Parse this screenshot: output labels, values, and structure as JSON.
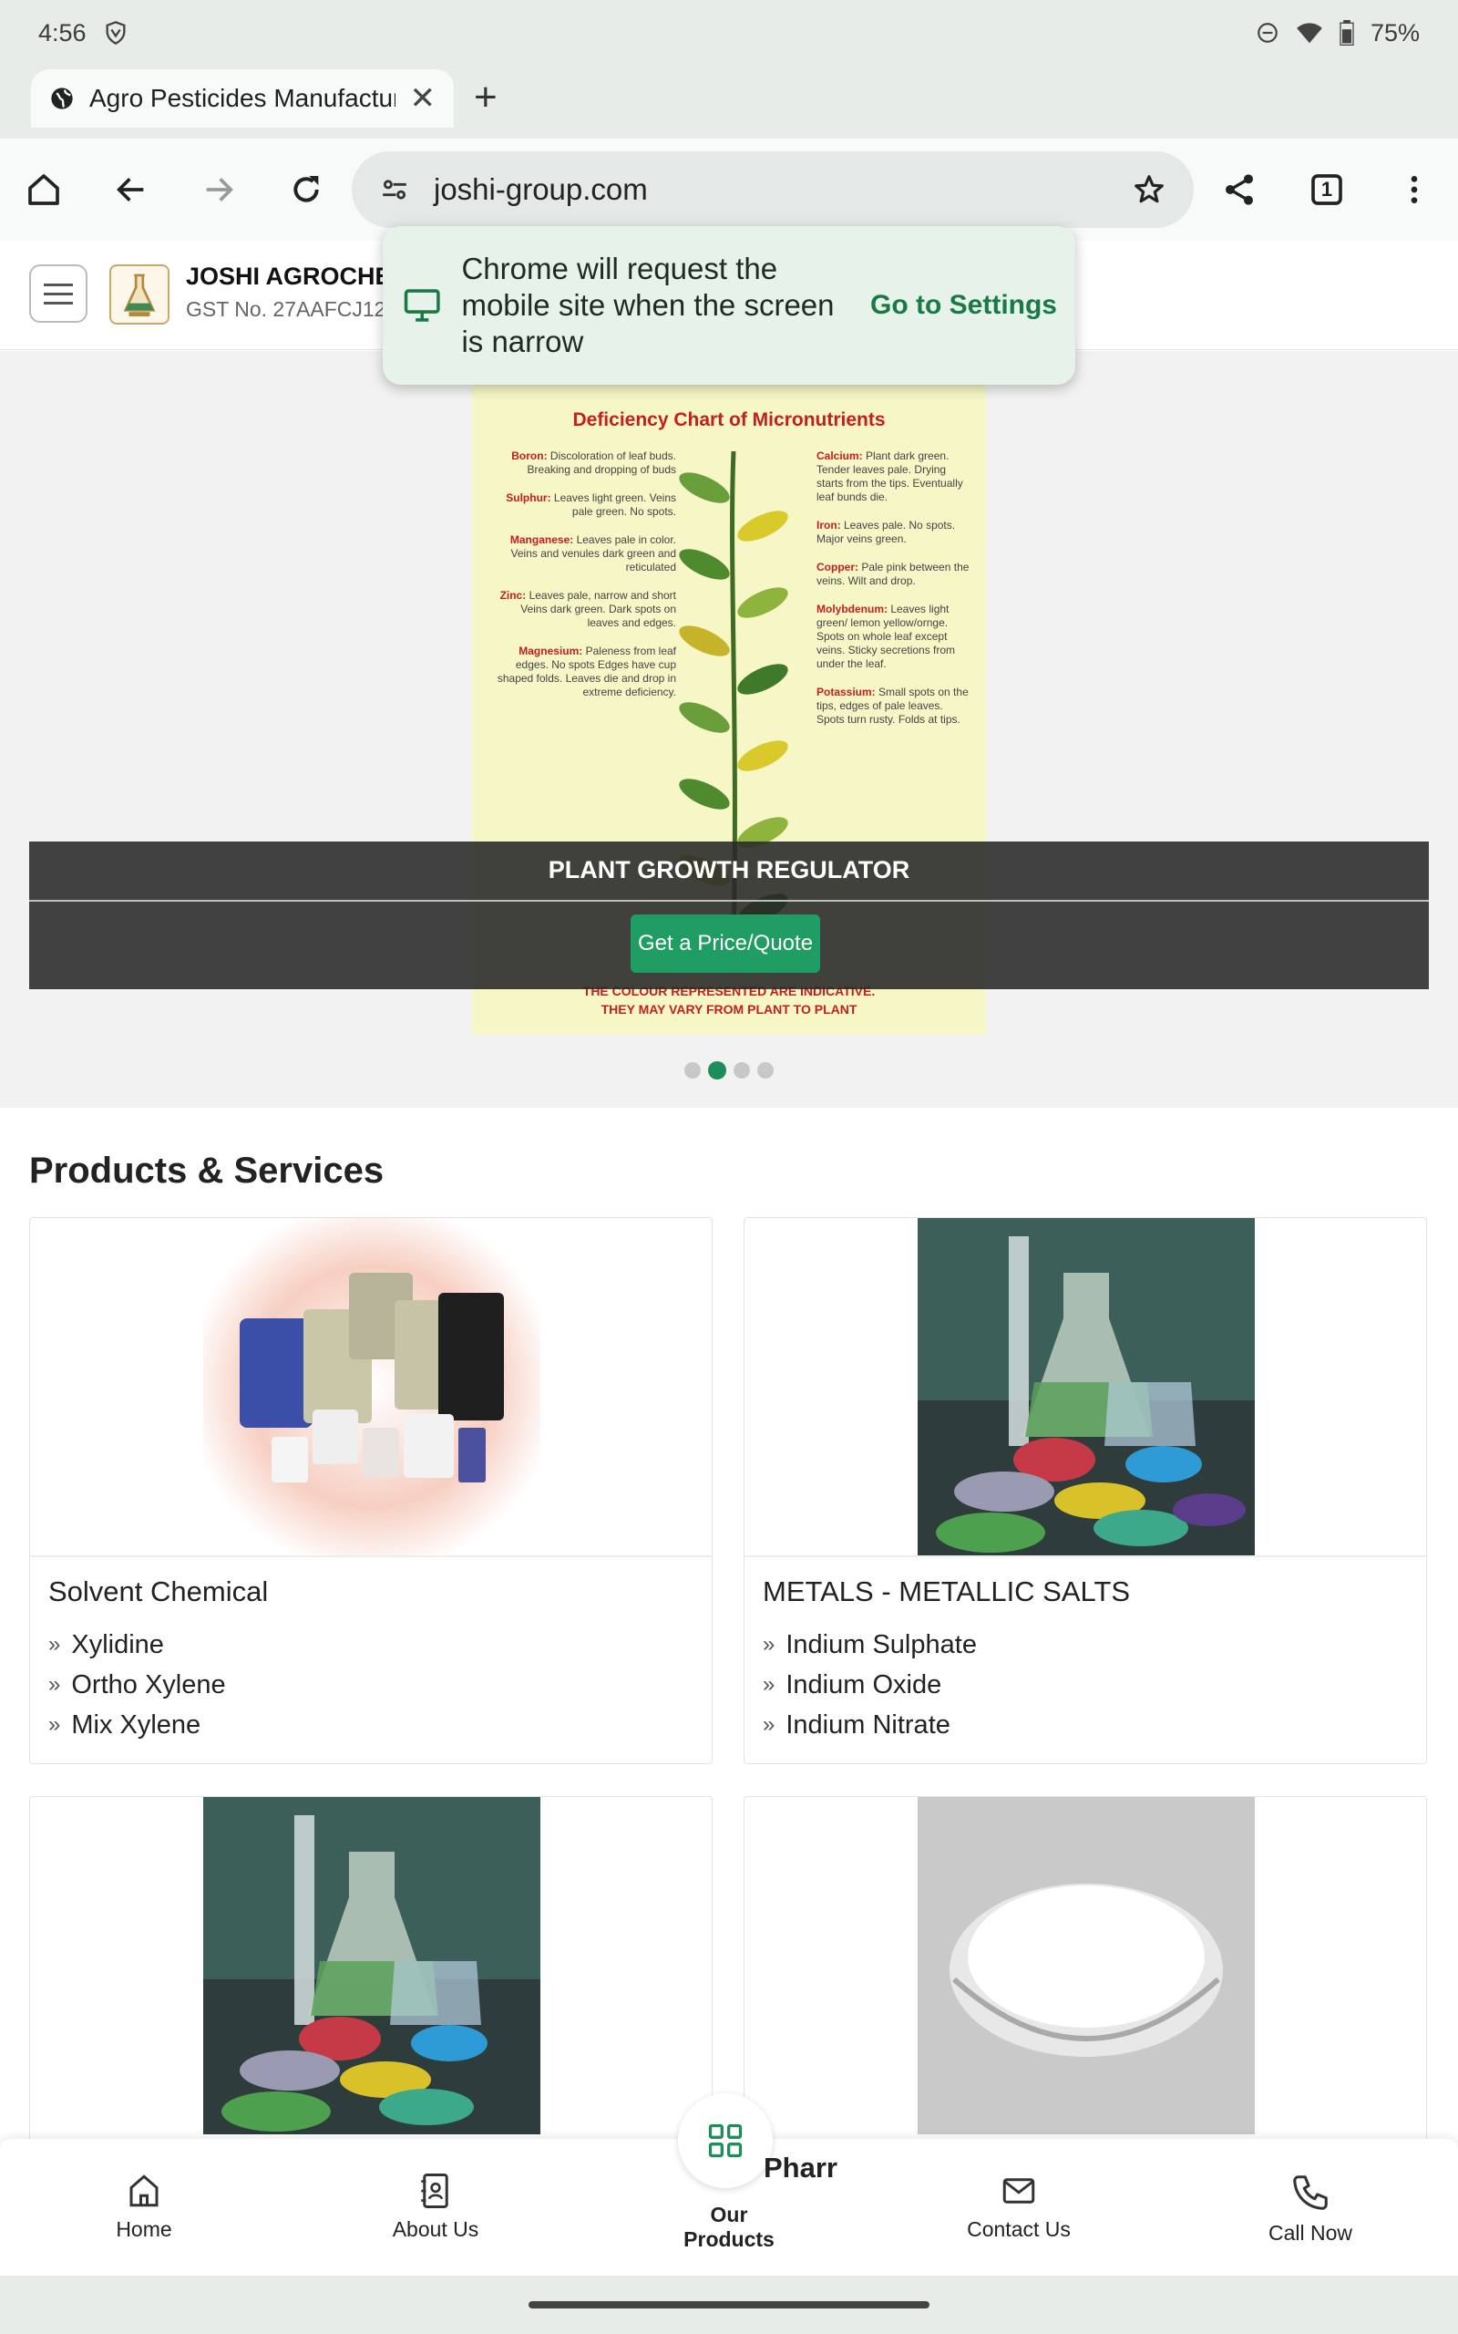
{
  "status_bar": {
    "time": "4:56",
    "battery": "75%"
  },
  "browser": {
    "tab_title": "Agro Pesticides Manufacturer",
    "url": "joshi-group.com",
    "tab_count": "1"
  },
  "popup": {
    "message": "Chrome will request the mobile site when the screen is narrow",
    "action": "Go to Settings"
  },
  "site": {
    "brand": "JOSHI AGROCHEM",
    "gst": "GST No. 27AAFCJ12"
  },
  "hero": {
    "chart_title": "Deficiency Chart of Micronutrients",
    "chart_left": [
      {
        "k": "Boron:",
        "v": "Discoloration of leaf buds. Breaking and dropping of buds"
      },
      {
        "k": "Sulphur:",
        "v": "Leaves light green. Veins pale green. No spots."
      },
      {
        "k": "Manganese:",
        "v": "Leaves pale in color. Veins and venules dark green and reticulated"
      },
      {
        "k": "Zinc:",
        "v": "Leaves pale, narrow and short Veins dark green. Dark spots on leaves and edges."
      },
      {
        "k": "Magnesium:",
        "v": "Paleness from leaf edges. No spots Edges have cup shaped folds. Leaves die and drop in extreme deficiency."
      }
    ],
    "chart_right": [
      {
        "k": "Calcium:",
        "v": "Plant dark green. Tender leaves pale. Drying starts from the tips. Eventually leaf bunds die."
      },
      {
        "k": "Iron:",
        "v": "Leaves pale. No spots. Major veins green."
      },
      {
        "k": "Copper:",
        "v": "Pale pink between the veins. Wilt and drop."
      },
      {
        "k": "Molybdenum:",
        "v": "Leaves light green/ lemon yellow/ornge. Spots on whole leaf except veins. Sticky secretions from under the leaf."
      },
      {
        "k": "Potassium:",
        "v": "Small spots on the tips, edges of pale leaves. Spots turn rusty. Folds at tips."
      }
    ],
    "chart_footer_1": "THE COLOUR REPRESENTED ARE INDICATIVE.",
    "chart_footer_2": "THEY MAY VARY FROM PLANT TO PLANT",
    "banner_title": "PLANT GROWTH REGULATOR",
    "quote_button": "Get a Price/Quote",
    "slide_count": 4,
    "active_slide": 1
  },
  "products": {
    "section_title": "Products & Services",
    "cards": [
      {
        "name": "Solvent Chemical",
        "items": [
          "Xylidine",
          "Ortho Xylene",
          "Mix Xylene"
        ]
      },
      {
        "name": "METALS - METALLIC SALTS",
        "items": [
          "Indium Sulphate",
          "Indium Oxide",
          "Indium Nitrate"
        ]
      }
    ],
    "peek_text": "Pharr"
  },
  "bottom_nav": {
    "home": "Home",
    "about": "About Us",
    "products_line1": "Our",
    "products_line2": "Products",
    "contact": "Contact Us",
    "call": "Call Now"
  }
}
